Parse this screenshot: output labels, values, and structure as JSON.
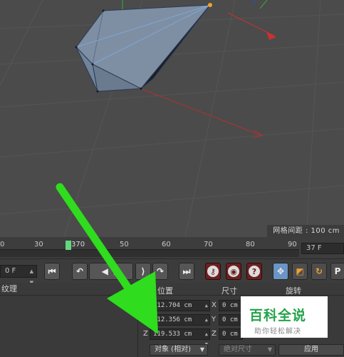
{
  "viewport": {
    "grid_spacing": "网格间距 : 100 cm"
  },
  "timeline": {
    "ticks": [
      "0",
      "30",
      "370",
      "50",
      "60",
      "70",
      "80",
      "90"
    ],
    "current_frame_label": "370",
    "frame_field": "37 F"
  },
  "transport": {
    "start_frame": "0 F",
    "icons": [
      "go-to-start-icon",
      "previous-key-icon",
      "play-backward-icon",
      "play-forward-icon",
      "next-key-icon",
      "go-to-end-icon",
      "record-key-icon",
      "auto-key-icon",
      "keyframe-help-icon",
      "move-tool-icon",
      "scale-tool-icon",
      "rotate-tool-icon",
      "p-tool-icon"
    ]
  },
  "left_panel": {
    "title": "纹理"
  },
  "coordinates": {
    "headers": {
      "position": "位置",
      "size": "尺寸",
      "rotation": "旋转"
    },
    "rows": [
      {
        "axis_pos": "",
        "pos": "112.704 cm",
        "axis_size": "X",
        "size": "0 cm"
      },
      {
        "axis_pos": "",
        "pos": "112.356 cm",
        "axis_size": "Y",
        "size": "0 cm"
      },
      {
        "axis_pos": "Z",
        "pos": "119.533 cm",
        "axis_size": "Z",
        "size": "0 cm"
      }
    ],
    "mode_dropdown": "对象 (相对)",
    "size_dropdown": "绝对尺寸",
    "apply_button": "应用"
  },
  "watermark": {
    "title": "百科全说",
    "subtitle": "助你轻松解决"
  },
  "colors": {
    "viewport_bg": "#4b4b4b",
    "object_fill": "#7d8fa3",
    "axis_red": "#c83232",
    "playhead": "#64d77e",
    "annotation_arrow": "#2fdc1e",
    "watermark_green": "#23a348"
  }
}
